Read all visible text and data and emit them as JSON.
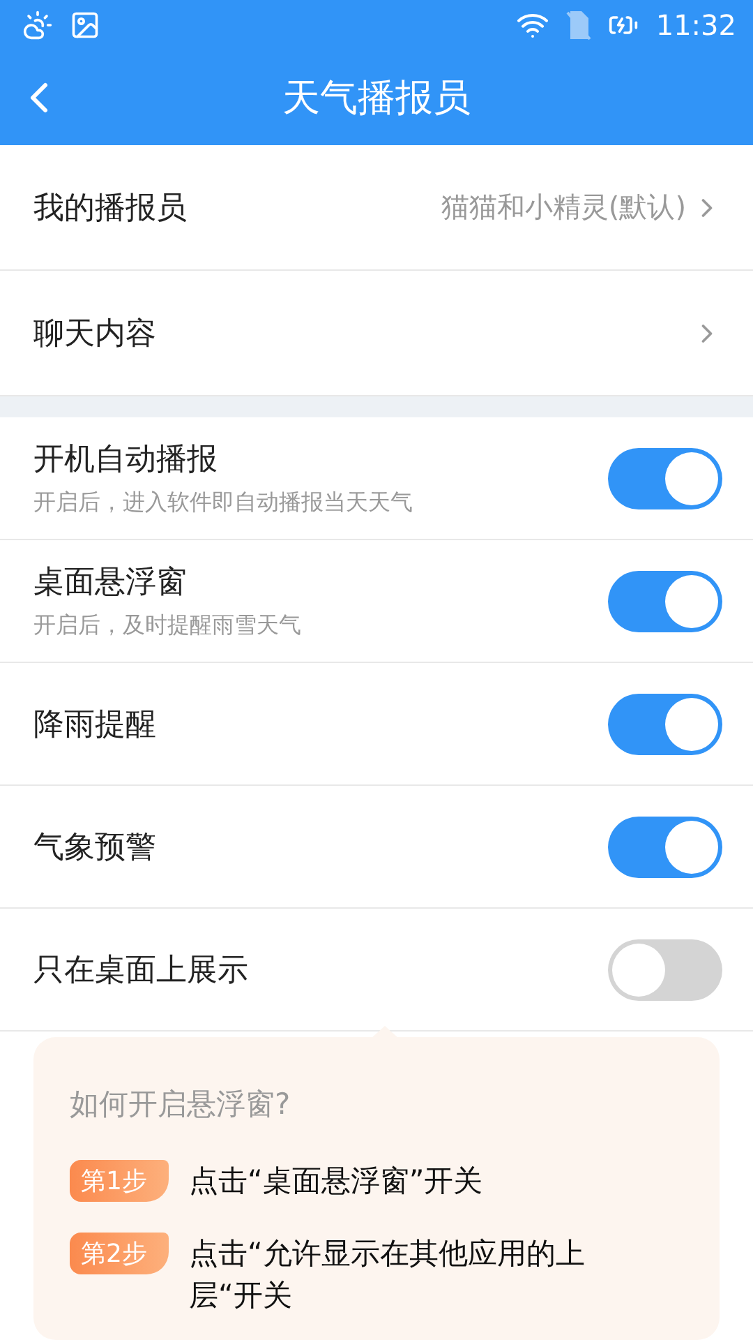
{
  "status_bar": {
    "time": "11:32"
  },
  "header": {
    "title": "天气播报员"
  },
  "nav_rows": [
    {
      "label": "我的播报员",
      "value": "猫猫和小精灵(默认)"
    },
    {
      "label": "聊天内容"
    }
  ],
  "toggle_rows": [
    {
      "label": "开机自动播报",
      "description": "开启后，进入软件即自动播报当天天气",
      "on": true
    },
    {
      "label": "桌面悬浮窗",
      "description": "开启后，及时提醒雨雪天气",
      "on": true
    },
    {
      "label": "降雨提醒",
      "on": true
    },
    {
      "label": "气象预警",
      "on": true
    },
    {
      "label": "只在桌面上展示",
      "on": false
    }
  ],
  "help_card": {
    "title": "如何开启悬浮窗?",
    "steps": [
      {
        "badge": "第1步",
        "text": "点击“桌面悬浮窗”开关"
      },
      {
        "badge": "第2步",
        "text": "点击“允许显示在其他应用的上层“开关"
      }
    ]
  }
}
